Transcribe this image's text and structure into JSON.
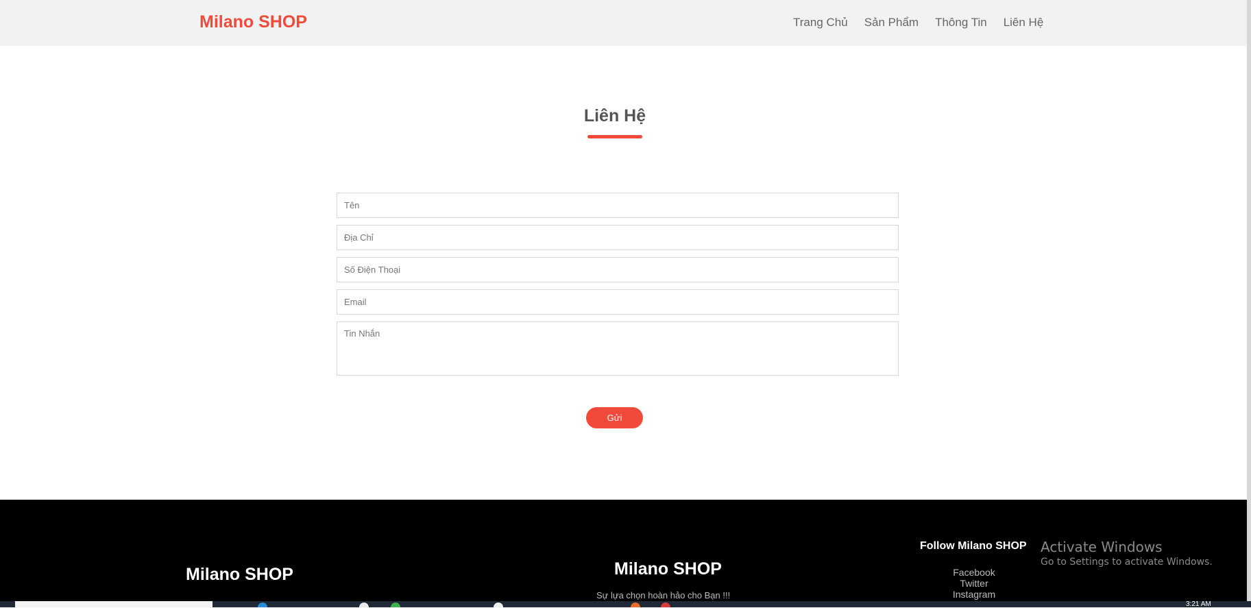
{
  "header": {
    "logo": "Milano SHOP",
    "nav": [
      "Trang Chủ",
      "Sản Phẩm",
      "Thông Tin",
      "Liên Hệ"
    ]
  },
  "contact": {
    "title": "Liên Hệ",
    "placeholders": {
      "name": "Tên",
      "address": "Địa Chỉ",
      "phone": "Số Điện Thoại",
      "email": "Email",
      "message": "Tin Nhắn"
    },
    "submit": "Gửi"
  },
  "footer": {
    "logo_left": "Milano SHOP",
    "logo_center": "Milano SHOP",
    "tagline": "Sự lựa chọn hoàn hảo cho Bạn !!!",
    "follow_title": "Follow Milano SHOP",
    "social": [
      "Facebook",
      "Twitter",
      "Instagram"
    ]
  },
  "watermark": {
    "title": "Activate Windows",
    "subtitle": "Go to Settings to activate Windows."
  },
  "taskbar": {
    "clock": "3:21 AM"
  },
  "colors": {
    "accent": "#f24a3a",
    "header_bg": "#f2f2f2",
    "footer_bg": "#000000"
  }
}
